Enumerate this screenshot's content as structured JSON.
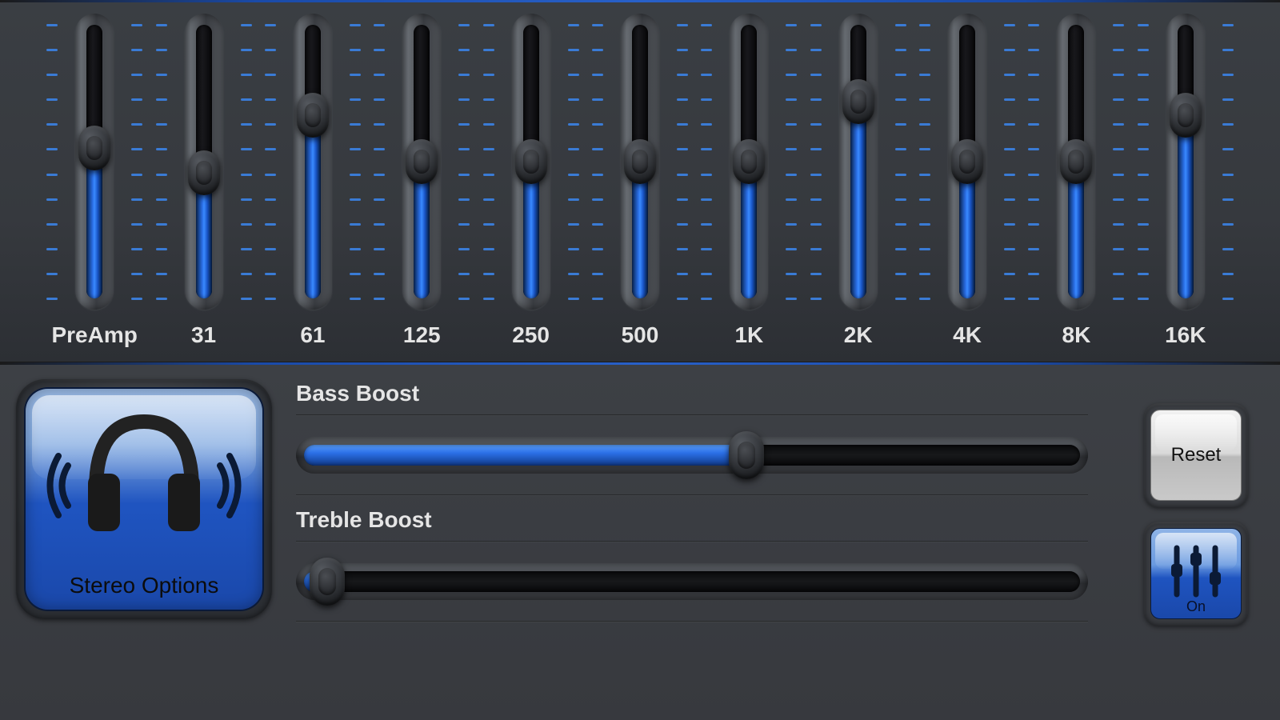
{
  "eq": {
    "bands": [
      {
        "label": "PreAmp",
        "value": 55
      },
      {
        "label": "31",
        "value": 46
      },
      {
        "label": "61",
        "value": 67
      },
      {
        "label": "125",
        "value": 50
      },
      {
        "label": "250",
        "value": 50
      },
      {
        "label": "500",
        "value": 50
      },
      {
        "label": "1K",
        "value": 50
      },
      {
        "label": "2K",
        "value": 72
      },
      {
        "label": "4K",
        "value": 50
      },
      {
        "label": "8K",
        "value": 50
      },
      {
        "label": "16K",
        "value": 67
      }
    ]
  },
  "boost": {
    "bass": {
      "label": "Bass Boost",
      "value": 57
    },
    "treble": {
      "label": "Treble Boost",
      "value": 3
    }
  },
  "stereo": {
    "label": "Stereo Options"
  },
  "buttons": {
    "reset": "Reset",
    "toggle": "On"
  }
}
